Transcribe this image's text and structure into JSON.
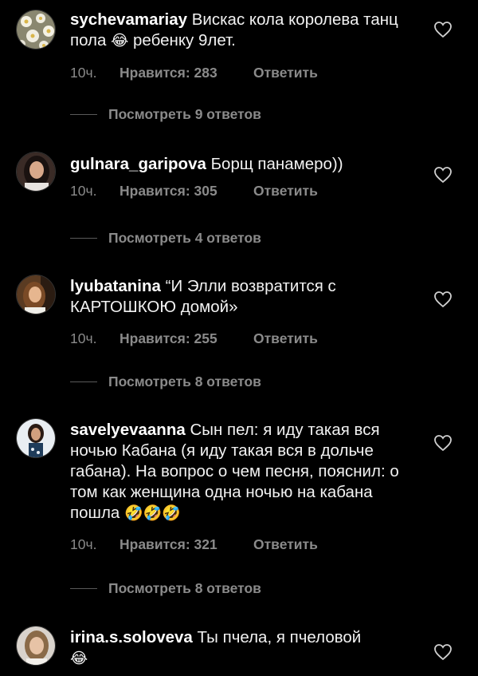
{
  "comments": [
    {
      "username": "sychevamariay",
      "text": "Вискас кола королева танц пола",
      "text_after": "ребенку 9лет.",
      "emoji": "😂",
      "time": "10ч.",
      "likes": "Нравится: 283",
      "reply": "Ответить",
      "view_replies": "Посмотреть 9 ответов"
    },
    {
      "username": "gulnara_garipova",
      "text": "Борщ панамеро))",
      "time": "10ч.",
      "likes": "Нравится: 305",
      "reply": "Ответить",
      "view_replies": "Посмотреть 4 ответов"
    },
    {
      "username": "lyubatanina",
      "text": "“И Элли возвратится с КАРТОШКОЮ домой»",
      "time": "10ч.",
      "likes": "Нравится: 255",
      "reply": "Ответить",
      "view_replies": "Посмотреть 8 ответов"
    },
    {
      "username": "savelyevaanna",
      "text": "Сын пел: я иду такая вся ночью Кабана (я иду такая вся в дольче габана). На вопрос о чем песня, пояснил: о том как женщина одна ночью на кабана пошла",
      "emoji": "🤣🤣🤣",
      "time": "10ч.",
      "likes": "Нравится: 321",
      "reply": "Ответить",
      "view_replies": "Посмотреть 8 ответов"
    },
    {
      "username": "irina.s.soloveva",
      "text": "Ты пчела, я пчеловой",
      "emoji": "😂"
    }
  ],
  "icons": {
    "like": "heart-outline-icon"
  },
  "colors": {
    "background": "#000000",
    "text": "#f2f2f2",
    "muted": "#8a8a8a"
  }
}
